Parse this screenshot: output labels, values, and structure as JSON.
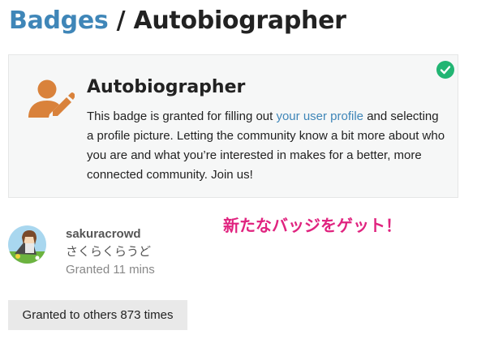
{
  "header": {
    "breadcrumb_root": "Badges",
    "separator": "/",
    "current": "Autobiographer"
  },
  "badge": {
    "name": "Autobiographer",
    "icon": "user-edit-icon",
    "icon_color": "#d9823b",
    "granted_check_icon": "check-circle-icon",
    "check_color": "#22b573",
    "description_before": "This badge is granted for filling out ",
    "description_link": "your user profile",
    "description_after": " and selecting a profile picture. Letting the community know a bit more about who you are and what you’re interested in makes for a better, more connected community. Join us!"
  },
  "grant": {
    "username": "sakuracrowd",
    "full_name": "さくらくらうど",
    "granted_time": "Granted 11 mins",
    "avatar_icon": "user-avatar"
  },
  "overlay_text": "新たなバッジをゲット！",
  "others_button": "Granted to others 873 times",
  "colors": {
    "link": "#3f86b8",
    "accent_overlay": "#e0237f",
    "card_bg": "#f6f7f7"
  }
}
